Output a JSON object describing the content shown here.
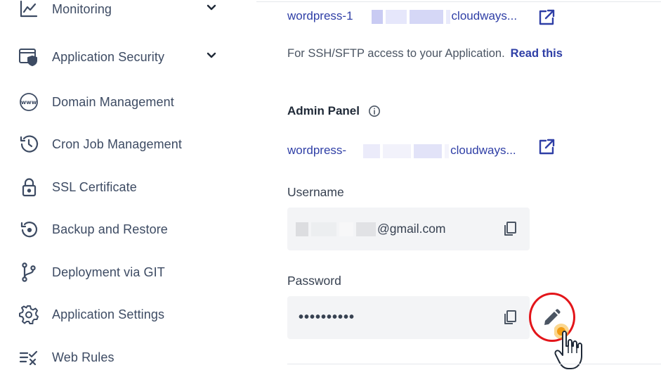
{
  "sidebar": {
    "items": [
      {
        "label": "Monitoring",
        "icon": "chart-line-icon",
        "chevron": true
      },
      {
        "label": "Application Security",
        "icon": "window-shield-icon",
        "chevron": true
      },
      {
        "label": "Domain Management",
        "icon": "www-globe-icon",
        "chevron": false
      },
      {
        "label": "Cron Job Management",
        "icon": "history-clock-icon",
        "chevron": false
      },
      {
        "label": "SSL Certificate",
        "icon": "lock-icon",
        "chevron": false
      },
      {
        "label": "Backup and Restore",
        "icon": "backup-restore-icon",
        "chevron": false
      },
      {
        "label": "Deployment via GIT",
        "icon": "git-branch-icon",
        "chevron": false
      },
      {
        "label": "Application Settings",
        "icon": "gear-icon",
        "chevron": false
      },
      {
        "label": "Web Rules",
        "icon": "rules-list-icon",
        "chevron": false
      }
    ]
  },
  "ssh": {
    "url_prefix": "wordpress-1",
    "url_suffix": "cloudways...",
    "note": "For SSH/SFTP access to your Application.",
    "read_link": "Read this"
  },
  "admin": {
    "title": "Admin Panel",
    "url_prefix": "wordpress-",
    "url_suffix": "cloudways...",
    "username_label": "Username",
    "username_value": "@gmail.com",
    "password_label": "Password",
    "password_value": "••••••••••"
  },
  "colors": {
    "link": "#2f3fa6",
    "highlight_ring": "#e3151a",
    "field_bg": "#f3f4f6",
    "icon": "#3d4b63"
  }
}
